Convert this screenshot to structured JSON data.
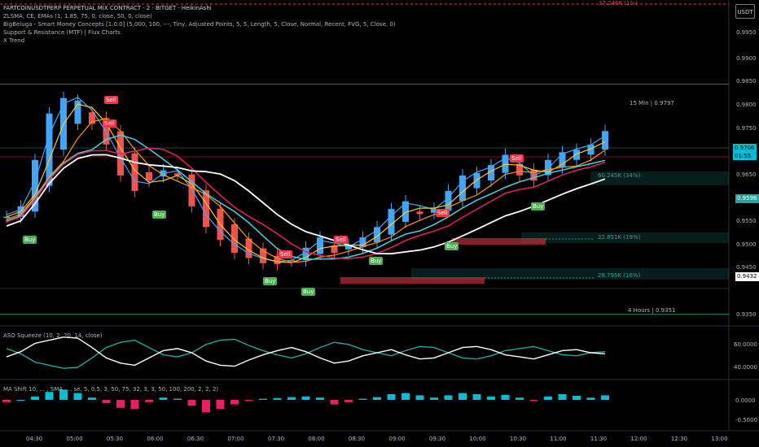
{
  "header": {
    "title": "FARTCOINUSDTPERP PERPETUAL MIX CONTRACT · 2 · BITGET · HeikinAshi",
    "indicators": [
      "ZLSMA, CE, EMAs (1, 1.85, 75, 0, close, 50, 0, close)",
      "BigBeluga - Smart Money Concepts [1.0.0] (5,000, 100, ---, Tiny, Adjusted Points, 5, 5, Length, 5, Close, Normal, Recent, FVG, 5, Close, 0)",
      "Support & Resistance (MTF) | Flux Charts",
      "X Trend"
    ],
    "unit_button": "USDT",
    "top_volume_label": "37.246K (1%)"
  },
  "price_scale": {
    "ticks": [
      "0.9950",
      "0.9900",
      "0.9850",
      "0.9800",
      "0.9750",
      "0.9650",
      "0.9550",
      "0.9500",
      "0.9450",
      "0.9350"
    ],
    "current_price": "0.9706",
    "countdown": "01:55",
    "labels": [
      {
        "value": "0.9596",
        "color": "#26a69a"
      },
      {
        "value": "0.9432",
        "color": "#ffffff"
      }
    ]
  },
  "levels": [
    {
      "text": "15 Min | 0.9797",
      "price": 0.9797,
      "color": "#f23645"
    },
    {
      "text": "4 Hours | 0.9351",
      "price": 0.9351,
      "color": "#26a69a"
    }
  ],
  "volume_zones": [
    {
      "text": "60.245K (34%)"
    },
    {
      "text": "22.851K (19%)"
    },
    {
      "text": "28.795K (16%)"
    }
  ],
  "signals": [
    {
      "text": "Buy",
      "type": "buy"
    },
    {
      "text": "Sell",
      "type": "sell"
    },
    {
      "text": "Buy",
      "type": "buy"
    },
    {
      "text": "Sell",
      "type": "sell"
    },
    {
      "text": "Buy",
      "type": "buy"
    },
    {
      "text": "Buy",
      "type": "buy"
    },
    {
      "text": "Sell",
      "type": "sell"
    },
    {
      "text": "Sell",
      "type": "sell"
    },
    {
      "text": "Buy",
      "type": "buy"
    },
    {
      "text": "Sell",
      "type": "sell"
    },
    {
      "text": "Buy",
      "type": "buy"
    },
    {
      "text": "Sell",
      "type": "sell"
    },
    {
      "text": "Buy",
      "type": "buy"
    }
  ],
  "oscillator": {
    "label": "ASO Squeeze (10, 2, 20, 14, close)",
    "ticks": [
      "60.0000",
      "40.0000"
    ]
  },
  "ma_shift": {
    "label": "MA Shift 10, ... , SMA, ... se, 5, 0.5, 3, 50, 75, 32, 3, 3, 50, 100, 200, 2, 2, 2)",
    "ticks": [
      "0.0000",
      "-0.5000"
    ]
  },
  "time_axis": [
    "04:30",
    "05:00",
    "05:30",
    "06:00",
    "06:30",
    "07:00",
    "07:30",
    "08:00",
    "08:30",
    "09:00",
    "09:30",
    "10:00",
    "10:30",
    "11:00",
    "11:30",
    "12:00",
    "12:30",
    "13:00"
  ],
  "colors": {
    "background": "#000000",
    "bull": "#26a69a",
    "bear": "#f23645",
    "heikin_up": "#42a5f5",
    "heikin_down": "#ef5350",
    "zlsma": "#ffffff",
    "ema_fast": "#ffca28",
    "ema_mid": "#ff9800",
    "ema_slow": "#e91e63",
    "trend": "#4dd0e1",
    "upper_band": "#42a5f5"
  },
  "chart_data": {
    "type": "candlestick",
    "ylim": [
      0.933,
      0.996
    ],
    "x": [
      "04:20",
      "04:30",
      "04:40",
      "04:50",
      "05:00",
      "05:10",
      "05:20",
      "05:30",
      "05:40",
      "05:50",
      "06:00",
      "06:10",
      "06:20",
      "06:30",
      "06:40",
      "06:50",
      "07:00",
      "07:10",
      "07:20",
      "07:30",
      "07:40",
      "07:50",
      "08:00",
      "08:10",
      "08:20",
      "08:30",
      "08:40",
      "08:50",
      "09:00",
      "09:10",
      "09:20",
      "09:30",
      "09:40",
      "09:50",
      "10:00",
      "10:10",
      "10:20",
      "10:30",
      "10:40",
      "10:50",
      "11:00",
      "11:10",
      "11:20"
    ],
    "close": [
      0.954,
      0.956,
      0.965,
      0.974,
      0.977,
      0.9765,
      0.972,
      0.968,
      0.962,
      0.959,
      0.961,
      0.963,
      0.962,
      0.956,
      0.952,
      0.9495,
      0.947,
      0.946,
      0.945,
      0.9448,
      0.9455,
      0.948,
      0.95,
      0.947,
      0.9485,
      0.95,
      0.952,
      0.9555,
      0.957,
      0.9545,
      0.9555,
      0.959,
      0.962,
      0.9625,
      0.964,
      0.966,
      0.962,
      0.961,
      0.965,
      0.9665,
      0.967,
      0.968,
      0.9706
    ],
    "oscillator_series": [
      {
        "name": "bull",
        "values": [
          54,
          49,
          41,
          38,
          35,
          36,
          45,
          55,
          60,
          62,
          55,
          48,
          46,
          50,
          58,
          62,
          63,
          57,
          52,
          48,
          45,
          49,
          55,
          60,
          58,
          53,
          50,
          47,
          52,
          56,
          55,
          50,
          45,
          44,
          47,
          52,
          54,
          56,
          52,
          48,
          47,
          50,
          51
        ]
      },
      {
        "name": "bear",
        "values": [
          46,
          51,
          59,
          62,
          65,
          64,
          55,
          45,
          40,
          38,
          45,
          52,
          54,
          50,
          42,
          38,
          37,
          43,
          48,
          52,
          55,
          51,
          45,
          40,
          42,
          47,
          50,
          53,
          48,
          44,
          45,
          50,
          55,
          56,
          53,
          48,
          46,
          44,
          48,
          52,
          53,
          50,
          49
        ]
      }
    ],
    "ma_shift": [
      -0.1,
      0.0,
      0.15,
      0.35,
      0.45,
      0.3,
      0.1,
      -0.15,
      -0.35,
      -0.4,
      -0.1,
      0.1,
      0.05,
      -0.25,
      -0.55,
      -0.4,
      -0.2,
      -0.05,
      0.05,
      0.08,
      0.12,
      0.15,
      0.1,
      -0.2,
      -0.1,
      0.05,
      0.12,
      0.25,
      0.3,
      0.2,
      0.1,
      0.2,
      0.3,
      0.25,
      0.15,
      0.22,
      0.1,
      -0.05,
      0.15,
      0.25,
      0.18,
      0.1,
      0.2
    ]
  }
}
